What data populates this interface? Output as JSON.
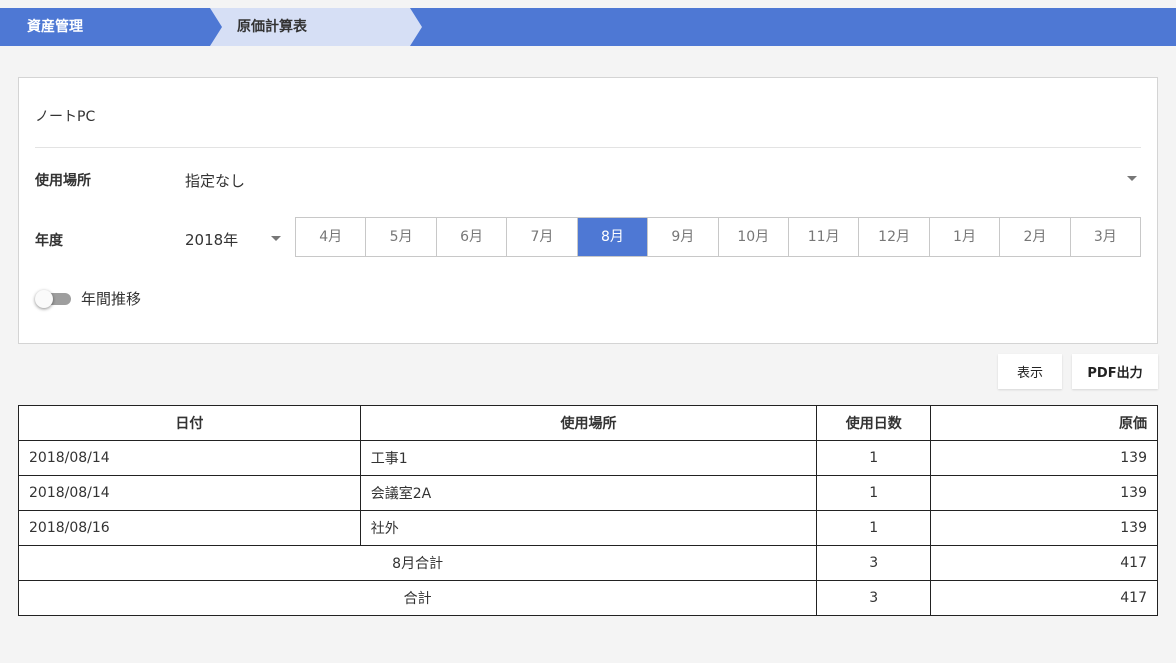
{
  "breadcrumb": {
    "items": [
      {
        "label": "資産管理"
      },
      {
        "label": "原価計算表"
      }
    ]
  },
  "panel": {
    "title": "ノートPC",
    "location_label": "使用場所",
    "location_value": "指定なし",
    "year_label": "年度",
    "year_value": "2018年",
    "months": [
      {
        "label": "4月",
        "active": false
      },
      {
        "label": "5月",
        "active": false
      },
      {
        "label": "6月",
        "active": false
      },
      {
        "label": "7月",
        "active": false
      },
      {
        "label": "8月",
        "active": true
      },
      {
        "label": "9月",
        "active": false
      },
      {
        "label": "10月",
        "active": false
      },
      {
        "label": "11月",
        "active": false
      },
      {
        "label": "12月",
        "active": false
      },
      {
        "label": "1月",
        "active": false
      },
      {
        "label": "2月",
        "active": false
      },
      {
        "label": "3月",
        "active": false
      }
    ],
    "toggle_label": "年間推移",
    "toggle_on": false
  },
  "actions": {
    "show_label": "表示",
    "pdf_label": "PDF出力"
  },
  "table": {
    "headers": [
      "日付",
      "使用場所",
      "使用日数",
      "原価"
    ],
    "rows": [
      {
        "date": "2018/08/14",
        "location": "工事1",
        "days": "1",
        "cost": "139"
      },
      {
        "date": "2018/08/14",
        "location": "会議室2A",
        "days": "1",
        "cost": "139"
      },
      {
        "date": "2018/08/16",
        "location": "社外",
        "days": "1",
        "cost": "139"
      }
    ],
    "month_total": {
      "label": "8月合計",
      "days": "3",
      "cost": "417"
    },
    "grand_total": {
      "label": "合計",
      "days": "3",
      "cost": "417"
    }
  },
  "colors": {
    "accent": "#4e78d4",
    "breadcrumb_current_bg": "#d6dff5"
  }
}
